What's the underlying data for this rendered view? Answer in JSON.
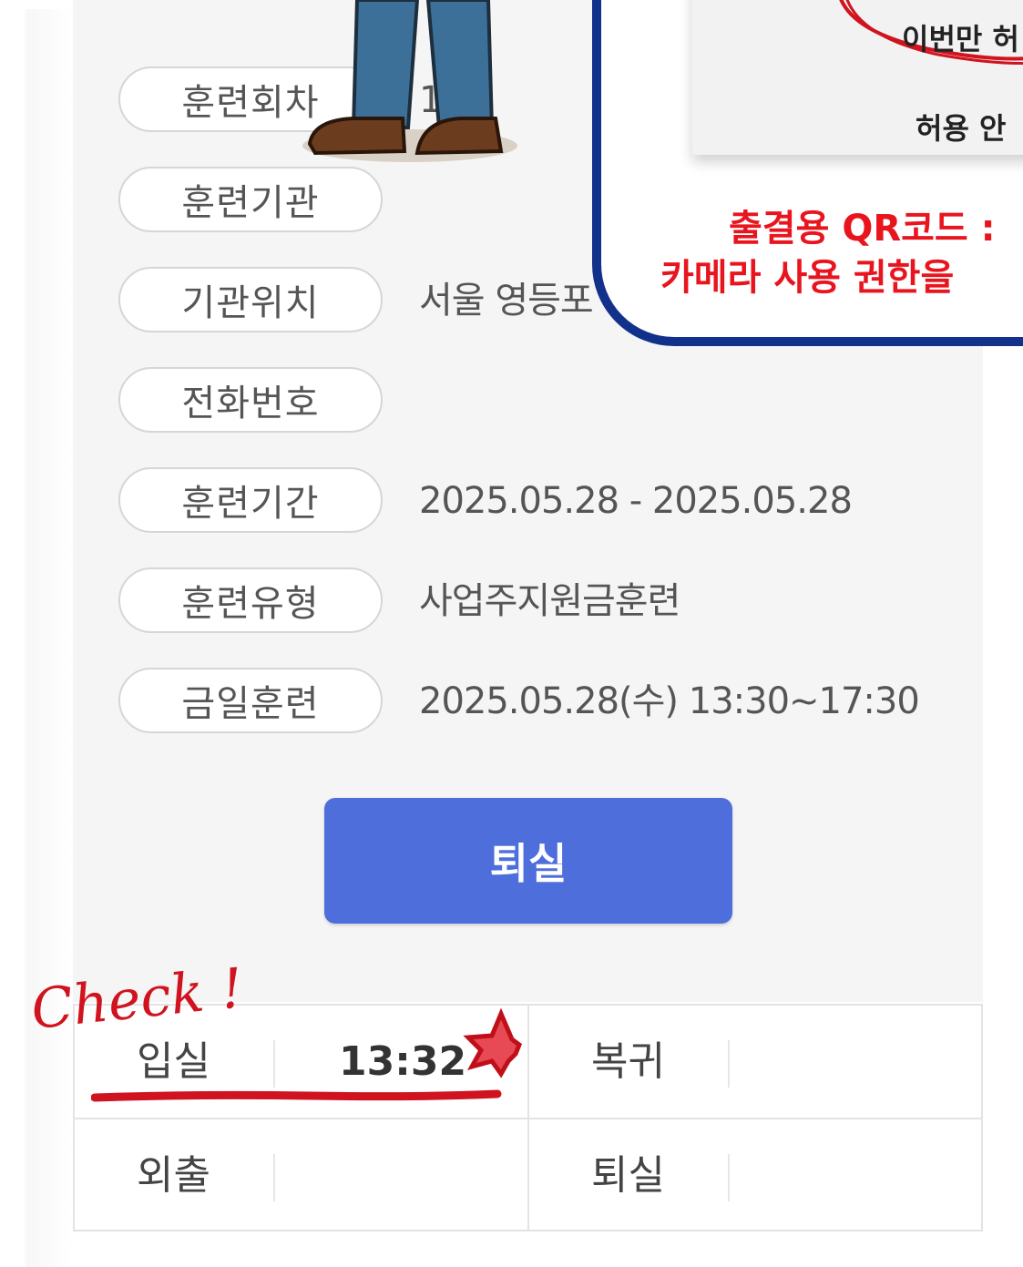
{
  "info_rows": [
    {
      "label": "훈련회차",
      "value": "1 차"
    },
    {
      "label": "훈련기관",
      "value": ""
    },
    {
      "label": "기관위치",
      "value": "서울 영등포"
    },
    {
      "label": "전화번호",
      "value": ""
    },
    {
      "label": "훈련기간",
      "value": "2025.05.28 - 2025.05.28"
    },
    {
      "label": "훈련유형",
      "value": "사업주지원금훈련"
    },
    {
      "label": "금일훈련",
      "value": "2025.05.28(수)   13:30~17:30"
    }
  ],
  "exit_button_label": "퇴실",
  "attendance": {
    "check_in_label": "입실",
    "check_in_time": "13:32",
    "return_label": "복귀",
    "return_time": "",
    "outing_label": "외출",
    "outing_time": "",
    "checkout_label": "퇴실",
    "checkout_time": ""
  },
  "annotation": {
    "handwritten": "Check !"
  },
  "popup": {
    "allow_once": "이번만 허",
    "deny": "허용 안",
    "message_line1": "출결용 QR코드 :",
    "message_line2": "카메라 사용 권한을"
  },
  "colors": {
    "button": "#4e6fdb",
    "annotation_red": "#d0141f",
    "popup_border": "#12318a",
    "popup_text_red": "#e8151f"
  }
}
